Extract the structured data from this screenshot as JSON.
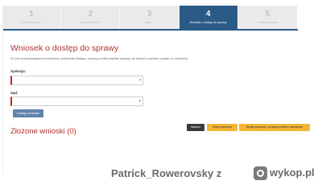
{
  "steps": [
    {
      "num": "1",
      "label": "Dane Osobowe I"
    },
    {
      "num": "2",
      "label": "Dane Osobowe II"
    },
    {
      "num": "3",
      "label": "Adres"
    },
    {
      "num": "4",
      "label": "Wniosek o dostęp do sprawy"
    },
    {
      "num": "5",
      "label": "Podsumowanie"
    }
  ],
  "active_step": 4,
  "form": {
    "title": "Wniosek o dostęp do sprawy",
    "hint": "W celu przeprowadzenia procedury udzielenia dostępu, proszę poniżej wybrać sprawy, do których powinien zostać on udzielony.",
    "field_appeal_label": "Apelacja:",
    "field_appeal_value": "",
    "field_court_label": "Sąd:",
    "field_court_value": "",
    "submit_access_label": "Dostęp wniosek"
  },
  "submitted": {
    "title": "Złożone wnioski (0)"
  },
  "footer_actions": {
    "back_label": "Wstecz",
    "send_label": "Wyślij wniosek",
    "send_signed_label": "Wyślij wniosek i podpisz profilem zaufanym"
  },
  "watermark": {
    "text": "Patrick_Rowerovsky z",
    "brand": "wykop.pl"
  }
}
